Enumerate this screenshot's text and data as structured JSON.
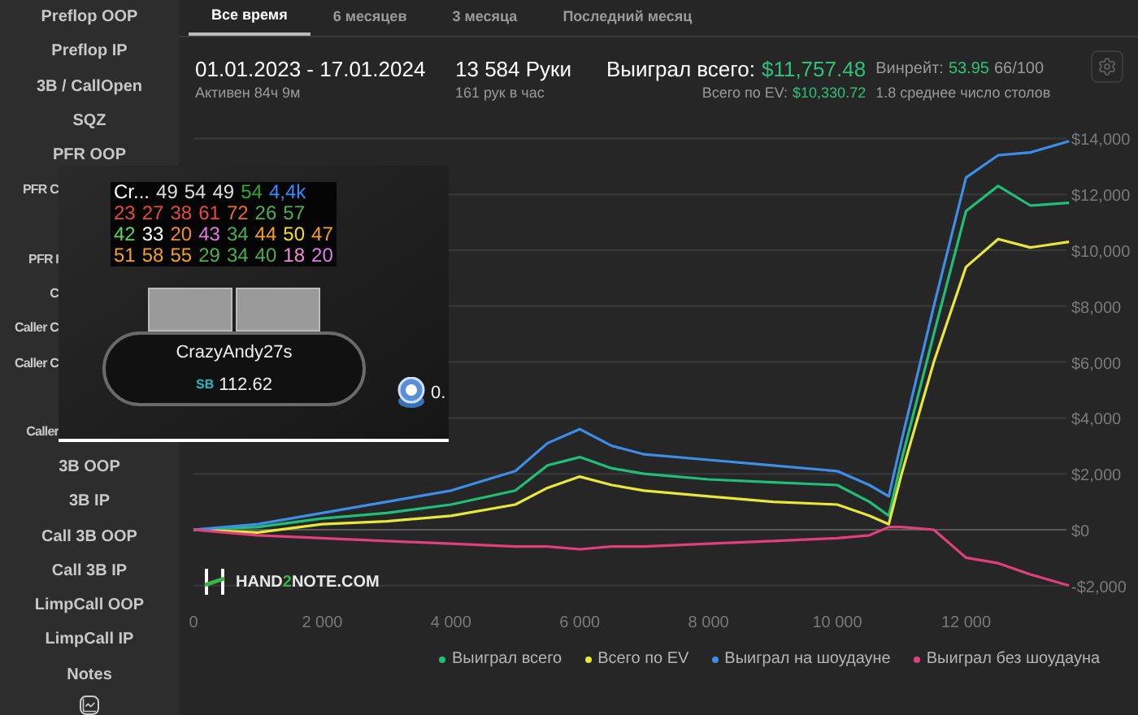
{
  "sidebar": {
    "items": [
      {
        "label": "Preflop OOP",
        "kind": "item"
      },
      {
        "label": "Preflop IP",
        "kind": "item"
      },
      {
        "label": "3B / CallOpen",
        "kind": "item"
      },
      {
        "label": "SQZ",
        "kind": "item"
      },
      {
        "label": "PFR OOP",
        "kind": "item"
      },
      {
        "label": "PFR C",
        "kind": "cut"
      },
      {
        "label": "PFR I",
        "kind": "cut"
      },
      {
        "label": "C",
        "kind": "cut"
      },
      {
        "label": "Caller C",
        "kind": "cut"
      },
      {
        "label": "Caller C",
        "kind": "cut"
      },
      {
        "label": "Caller",
        "kind": "cut"
      },
      {
        "label": "3B OOP",
        "kind": "item"
      },
      {
        "label": "3B IP",
        "kind": "item"
      },
      {
        "label": "Call 3B OOP",
        "kind": "item"
      },
      {
        "label": "Call 3B IP",
        "kind": "item"
      },
      {
        "label": "LimpCall OOP",
        "kind": "item"
      },
      {
        "label": "LimpCall IP",
        "kind": "item"
      },
      {
        "label": "Notes",
        "kind": "item"
      }
    ]
  },
  "tabs": [
    {
      "label": "Все время",
      "selected": true
    },
    {
      "label": "6 месяцев",
      "selected": false
    },
    {
      "label": "3 месяца",
      "selected": false
    },
    {
      "label": "Последний месяц",
      "selected": false
    }
  ],
  "summary": {
    "period": "01.01.2023 - 17.01.2024",
    "active": "Активен 84ч 9м",
    "hands": "13 584 Руки",
    "hands_rate": "161 рук в час",
    "won_label": "Выиграл всего:",
    "won_value": "$11,757.48",
    "ev_label": "Всего по EV:",
    "ev_value": "$10,330.72",
    "winrate_label": "Винрейт:",
    "winrate_value": "53.95",
    "winrate_rest": "66/100",
    "tables": "1.8 среднее число столов"
  },
  "chart": {
    "logo": {
      "before": "HAND",
      "accent": "2",
      "after": "NOTE.COM"
    },
    "chart_data": {
      "type": "line",
      "x": [
        0,
        1000,
        2000,
        3000,
        4000,
        5000,
        5500,
        6000,
        6500,
        7000,
        8000,
        9000,
        10000,
        10500,
        10800,
        11000,
        11500,
        12000,
        12500,
        13000,
        13600
      ],
      "xlim": [
        0,
        13600
      ],
      "ylim": [
        -2000,
        14000
      ],
      "grid": true,
      "legend": "bottom",
      "xticks": [
        {
          "value": 0,
          "label": "0"
        },
        {
          "value": 2000,
          "label": "2 000"
        },
        {
          "value": 4000,
          "label": "4 000"
        },
        {
          "value": 6000,
          "label": "6 000"
        },
        {
          "value": 8000,
          "label": "8 000"
        },
        {
          "value": 10000,
          "label": "10 000"
        },
        {
          "value": 12000,
          "label": "12 000"
        }
      ],
      "yticks": [
        {
          "value": -2000,
          "label": "-$2,000"
        },
        {
          "value": 0,
          "label": "$0"
        },
        {
          "value": 2000,
          "label": "$2,000"
        },
        {
          "value": 4000,
          "label": "$4,000"
        },
        {
          "value": 6000,
          "label": "$6,000"
        },
        {
          "value": 8000,
          "label": "$8,000"
        },
        {
          "value": 10000,
          "label": "$10,000"
        },
        {
          "value": 12000,
          "label": "$12,000"
        },
        {
          "value": 14000,
          "label": "$14,000"
        }
      ],
      "series": [
        {
          "name": "Выиграл всего",
          "color": "#1fbf7a",
          "values": [
            0,
            100,
            400,
            600,
            900,
            1400,
            2300,
            2600,
            2200,
            2000,
            1800,
            1700,
            1600,
            1000,
            500,
            2500,
            7000,
            11400,
            12300,
            11600,
            11700
          ]
        },
        {
          "name": "Всего по EV",
          "color": "#e8e83a",
          "values": [
            0,
            -100,
            200,
            300,
            500,
            900,
            1500,
            1900,
            1600,
            1400,
            1200,
            1000,
            900,
            500,
            200,
            2000,
            6000,
            9400,
            10400,
            10100,
            10300
          ]
        },
        {
          "name": "Выиграл на шоудауне",
          "color": "#3d8ee8",
          "values": [
            0,
            200,
            600,
            1000,
            1400,
            2100,
            3100,
            3600,
            3000,
            2700,
            2500,
            2300,
            2100,
            1600,
            1200,
            3200,
            8000,
            12600,
            13400,
            13500,
            13900
          ]
        },
        {
          "name": "Выиграл без шоудауна",
          "color": "#e0407a",
          "values": [
            0,
            -200,
            -300,
            -400,
            -500,
            -600,
            -600,
            -700,
            -600,
            -600,
            -500,
            -400,
            -300,
            -200,
            100,
            100,
            0,
            -1000,
            -1200,
            -1600,
            -2000
          ]
        }
      ]
    }
  },
  "hud": {
    "stats": [
      [
        {
          "text": "Cr...",
          "color": "#ffffff"
        },
        {
          "text": "49",
          "color": "#dddddd"
        },
        {
          "text": "54",
          "color": "#dddddd"
        },
        {
          "text": "49",
          "color": "#dddddd"
        },
        {
          "text": "54",
          "color": "#2fa82f"
        },
        {
          "text": "4,4k",
          "color": "#2b8fff"
        }
      ],
      [
        {
          "text": "23",
          "color": "#e64a3c"
        },
        {
          "text": "27",
          "color": "#e64a3c"
        },
        {
          "text": "38",
          "color": "#e64a3c"
        },
        {
          "text": "61",
          "color": "#e64a3c"
        },
        {
          "text": "72",
          "color": "#f06a30"
        },
        {
          "text": "26",
          "color": "#4caf50"
        },
        {
          "text": "57",
          "color": "#4caf50"
        }
      ],
      [
        {
          "text": "42",
          "color": "#5bd65b"
        },
        {
          "text": "33",
          "color": "#ffffff"
        },
        {
          "text": "20",
          "color": "#f5901e"
        },
        {
          "text": "43",
          "color": "#e07be0"
        },
        {
          "text": "34",
          "color": "#4caf50"
        },
        {
          "text": "44",
          "color": "#f5a01e"
        },
        {
          "text": "50",
          "color": "#f5e01e"
        },
        {
          "text": "47",
          "color": "#f5a01e"
        }
      ],
      [
        {
          "text": "51",
          "color": "#f5a01e"
        },
        {
          "text": "58",
          "color": "#f5a01e"
        },
        {
          "text": "55",
          "color": "#f5a01e"
        },
        {
          "text": "29",
          "color": "#4caf50"
        },
        {
          "text": "34",
          "color": "#4caf50"
        },
        {
          "text": "40",
          "color": "#4caf50"
        },
        {
          "text": "18",
          "color": "#f08ad8"
        },
        {
          "text": "20",
          "color": "#d980e6"
        }
      ]
    ],
    "player": "CrazyAndy27s",
    "position": "SB",
    "stack": "112.62",
    "bet": "0."
  }
}
